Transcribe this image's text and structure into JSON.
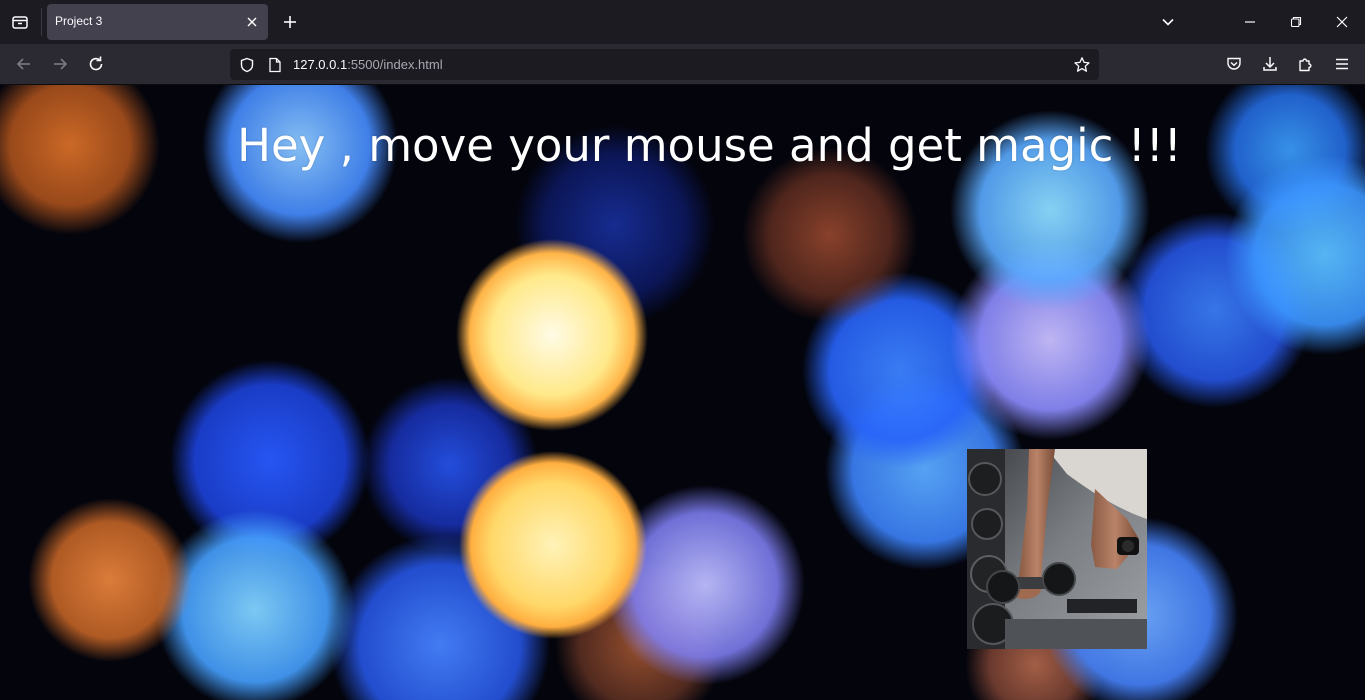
{
  "browser": {
    "tab": {
      "title": "Project 3",
      "active": true
    },
    "url": {
      "host": "127.0.0.1",
      "rest": ":5500/index.html"
    },
    "icons": {
      "tab_list": "tab-list-icon",
      "tab_close": "close-icon",
      "new_tab": "plus-icon",
      "list_all_tabs": "chevron-down-icon",
      "minimize": "minimize-icon",
      "restore": "restore-icon",
      "close_window": "close-icon",
      "back": "arrow-left-icon",
      "forward": "arrow-right-icon",
      "reload": "reload-icon",
      "site_info": "shield-icon",
      "page": "page-icon",
      "bookmark": "star-icon",
      "pocket": "pocket-icon",
      "downloads": "download-icon",
      "extensions": "puzzle-icon",
      "menu": "hamburger-icon"
    },
    "colors": {
      "tabstrip": "#1c1b22",
      "toolbar": "#2b2a33",
      "active_tab": "#42414d",
      "urlbar": "#1c1b22",
      "text": "#fbfbfe"
    }
  },
  "page": {
    "heading": "Hey , move your mouse and get magic !!!",
    "background": "blue, orange and yellow bokeh lights on dark background",
    "photo": "gym dumbbell photo",
    "colors": {
      "heading": "#ffffff",
      "background": "#03040c"
    }
  }
}
